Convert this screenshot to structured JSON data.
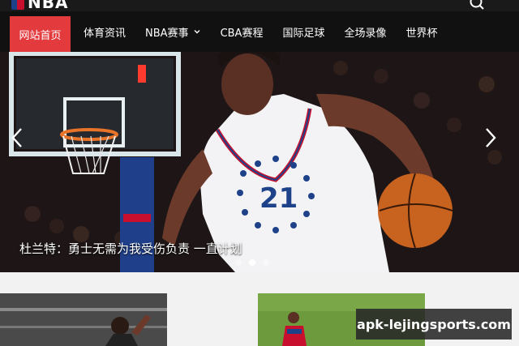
{
  "header": {
    "logo_text": "NBA",
    "search_icon": "search-icon"
  },
  "nav": {
    "items": [
      {
        "label": "网站首页",
        "active": true
      },
      {
        "label": "体育资讯"
      },
      {
        "label": "NBA赛事",
        "dropdown": true
      },
      {
        "label": "CBA赛程"
      },
      {
        "label": "国际足球"
      },
      {
        "label": "全场录像"
      },
      {
        "label": "世界杯"
      }
    ],
    "active_color": "#e33a3e"
  },
  "hero": {
    "caption": "杜兰特：勇士无需为我受伤负责 一直计划",
    "jersey_number": "21",
    "slide_count": 3,
    "active_slide": 2
  },
  "watermark": {
    "text": "apk-lejingsports.com"
  }
}
